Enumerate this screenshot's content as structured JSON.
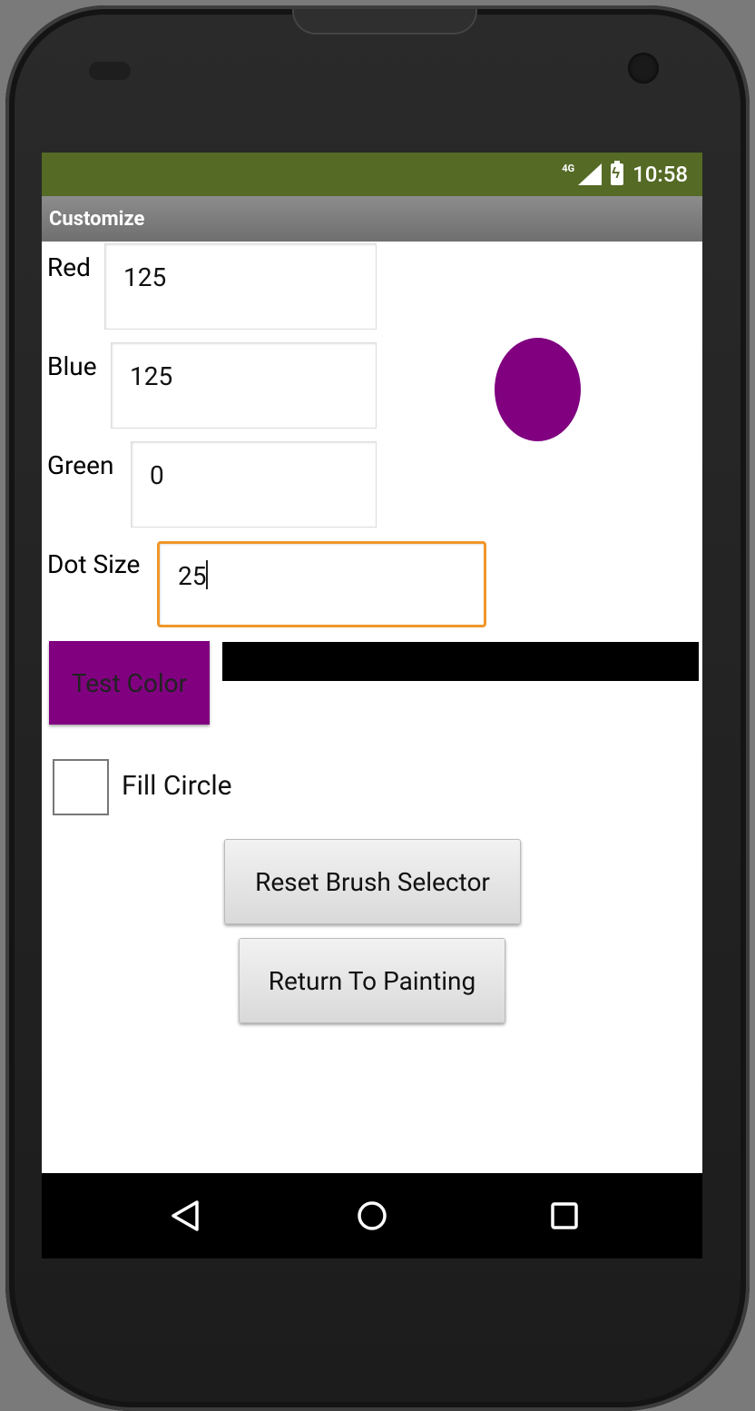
{
  "status_bar": {
    "network": "4G",
    "time": "10:58",
    "color": "#546a25"
  },
  "title_bar": {
    "title": "Customize"
  },
  "form": {
    "red_label": "Red",
    "red_value": "125",
    "blue_label": "Blue",
    "blue_value": "125",
    "green_label": "Green",
    "green_value": "0",
    "dot_size_label": "Dot Size",
    "dot_size_value": "25"
  },
  "preview": {
    "dot_color": "#800080"
  },
  "test_color_button": {
    "label": "Test Color",
    "color": "#800080"
  },
  "fill_circle": {
    "label": "Fill Circle",
    "checked": false
  },
  "buttons": {
    "reset_label": "Reset Brush Selector",
    "return_label": "Return To Painting"
  },
  "nav": {
    "back_icon": "back-triangle-icon",
    "home_icon": "home-circle-icon",
    "recents_icon": "recents-square-icon"
  }
}
